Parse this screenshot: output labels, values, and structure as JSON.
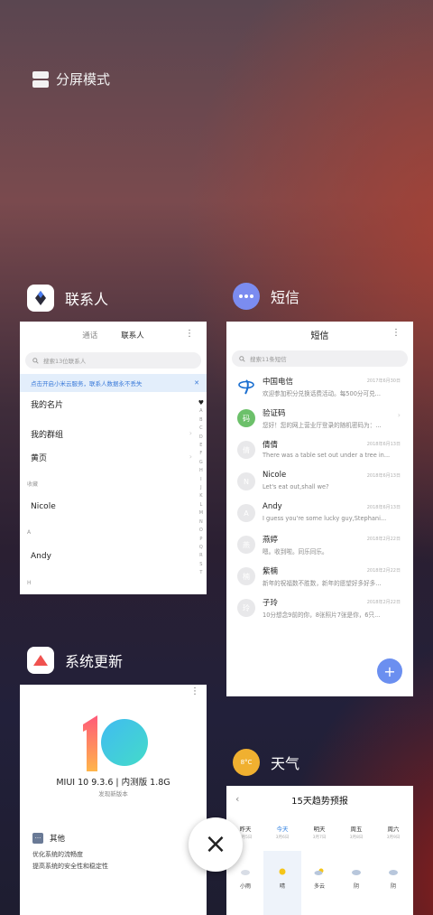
{
  "split_screen": {
    "label": "分屏模式"
  },
  "close": {
    "label": "×"
  },
  "contacts": {
    "app_label": "联系人",
    "tab_calls": "通话",
    "tab_contacts": "联系人",
    "menu": "⋮",
    "search_placeholder": "搜索13位联系人",
    "banner": "点击开启小米云服务，联系人数据永不丢失",
    "banner_close": "✕",
    "my_card": "我的名片",
    "my_groups": "我的群组",
    "yellow_pages": "黄页",
    "section_fav": "收藏",
    "c1": "Nicole",
    "section_a": "A",
    "c2": "Andy",
    "section_h": "H",
    "alpha": [
      "♥",
      "A",
      "B",
      "C",
      "D",
      "E",
      "F",
      "G",
      "H",
      "I",
      "J",
      "K",
      "L",
      "M",
      "N",
      "O",
      "P",
      "Q",
      "R",
      "S",
      "T"
    ]
  },
  "messages": {
    "app_label": "短信",
    "title": "短信",
    "menu": "⋮",
    "search_placeholder": "搜索11条短信",
    "items": [
      {
        "avatar": "",
        "name": "中国电信",
        "preview": "欢迎参加积分兑换话费活动。每500分可兑...",
        "date": "2017年6月30日"
      },
      {
        "avatar": "码",
        "name": "验证码",
        "preview": "您好！您的网上营业厅登录的随机密码为：...",
        "date": ""
      },
      {
        "avatar": "倩",
        "name": "倩倩",
        "preview": "There was a table set out under a tree in...",
        "date": "2018年6月13日"
      },
      {
        "avatar": "N",
        "name": "Nicole",
        "preview": "Let's eat out,shall we?",
        "date": "2018年6月13日"
      },
      {
        "avatar": "A",
        "name": "Andy",
        "preview": "I guess you're some lucky guy,Stephani...",
        "date": "2018年6月13日"
      },
      {
        "avatar": "燕",
        "name": "燕婷",
        "preview": "嗯。收到啦。同乐同乐。",
        "date": "2018年2月22日"
      },
      {
        "avatar": "楠",
        "name": "紫楠",
        "preview": "新年的祝福数不胜数，新年的愿望好多好多...",
        "date": "2018年2月22日"
      },
      {
        "avatar": "玲",
        "name": "子玲",
        "preview": "10分想念9前的你，8张照片7张是你，6只...",
        "date": "2018年2月22日"
      }
    ],
    "fab": "+"
  },
  "updater": {
    "app_label": "系统更新",
    "menu": "⋮",
    "version": "MIUI 10 9.3.6 | 内测版 1.8G",
    "sub": "发现新版本",
    "other_label": "其他",
    "line1": "优化系统的流畅度",
    "line2": "提高系统的安全性和稳定性"
  },
  "weather": {
    "app_label": "天气",
    "icon_text": "8°C",
    "title": "15天趋势预报",
    "back": "‹",
    "days": [
      {
        "day": "昨天",
        "date": "3月5日",
        "cond": "小雨"
      },
      {
        "day": "今天",
        "date": "3月6日",
        "cond": "晴"
      },
      {
        "day": "明天",
        "date": "3月7日",
        "cond": "多云"
      },
      {
        "day": "周五",
        "date": "3月8日",
        "cond": "阴"
      },
      {
        "day": "周六",
        "date": "3月9日",
        "cond": "阴"
      }
    ]
  }
}
